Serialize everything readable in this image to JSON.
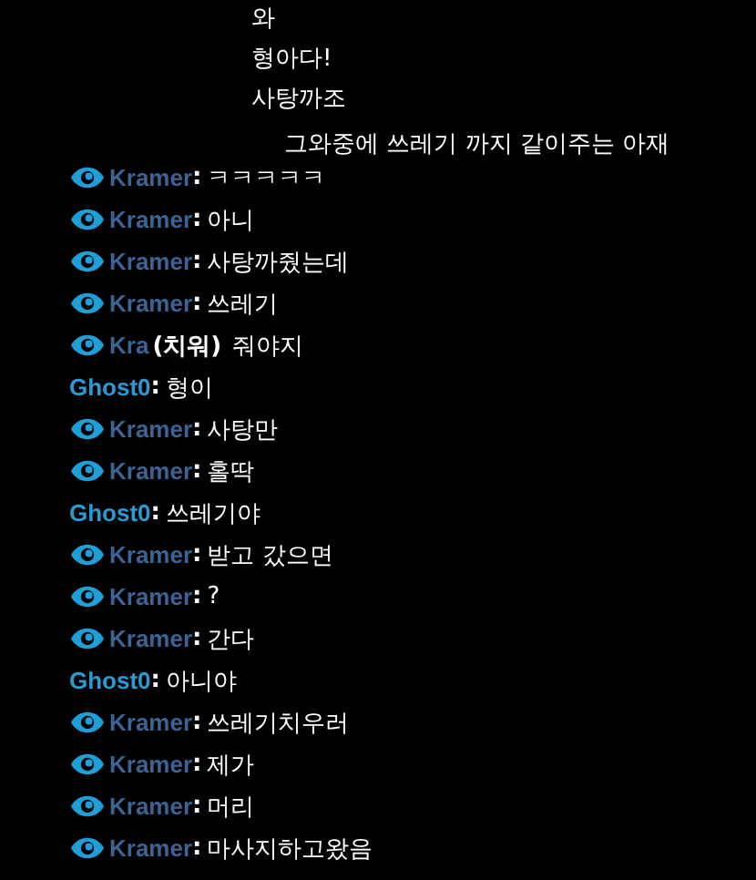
{
  "captions": [
    {
      "text": "와",
      "indent": false
    },
    {
      "text": "형아다!",
      "indent": false
    },
    {
      "text": "사탕까조",
      "indent": false
    },
    {
      "text": "그와중에 쓰레기 까지 같이주는 아재",
      "indent": true
    }
  ],
  "chat": [
    {
      "user": "Kramer",
      "badge": true,
      "separator": ":",
      "message": "ㅋㅋㅋㅋㅋ"
    },
    {
      "user": "Kramer",
      "badge": true,
      "separator": ":",
      "message": "아니"
    },
    {
      "user": "Kramer",
      "badge": true,
      "separator": ":",
      "message": "사탕까줬는데"
    },
    {
      "user": "Kramer",
      "badge": true,
      "separator": ":",
      "message": "쓰레기"
    },
    {
      "user": "Kra",
      "badge": true,
      "overlay": "(치워)",
      "message": "줘야지"
    },
    {
      "user": "Ghost0",
      "badge": false,
      "separator": ":",
      "message": "형이"
    },
    {
      "user": "Kramer",
      "badge": true,
      "separator": ":",
      "message": "사탕만"
    },
    {
      "user": "Kramer",
      "badge": true,
      "separator": ":",
      "message": "홀딱"
    },
    {
      "user": "Ghost0",
      "badge": false,
      "separator": ":",
      "message": "쓰레기야"
    },
    {
      "user": "Kramer",
      "badge": true,
      "separator": ":",
      "message": "받고 갔으면"
    },
    {
      "user": "Kramer",
      "badge": true,
      "separator": ":",
      "message": "?"
    },
    {
      "user": "Kramer",
      "badge": true,
      "separator": ":",
      "message": "간다"
    },
    {
      "user": "Ghost0",
      "badge": false,
      "separator": ":",
      "message": "아니야"
    },
    {
      "user": "Kramer",
      "badge": true,
      "separator": ":",
      "message": "쓰레기치우러"
    },
    {
      "user": "Kramer",
      "badge": true,
      "separator": ":",
      "message": "제가"
    },
    {
      "user": "Kramer",
      "badge": true,
      "separator": ":",
      "message": "머리"
    },
    {
      "user": "Kramer",
      "badge": true,
      "separator": ":",
      "message": "마사지하고왔음"
    }
  ]
}
